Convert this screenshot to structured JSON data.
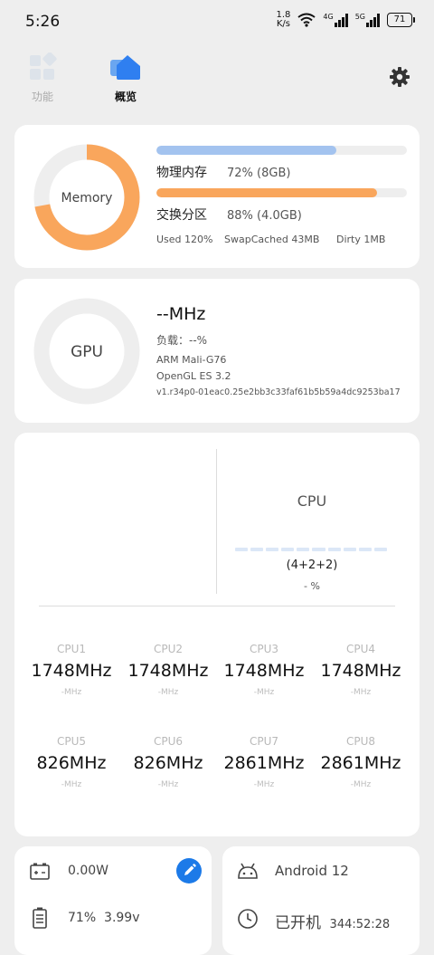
{
  "status_bar": {
    "time": "5:26",
    "net_speed_value": "1.8",
    "net_speed_unit": "K/s",
    "signal1_label": "4G",
    "signal2_label": "5G",
    "battery": "71"
  },
  "tabs": [
    {
      "label": "功能"
    },
    {
      "label": "概览"
    }
  ],
  "memory": {
    "ring_label": "Memory",
    "ram_label": "物理内存",
    "ram_value": "72% (8GB)",
    "ram_percent": 72,
    "swap_label": "交换分区",
    "swap_value": "88% (4.0GB)",
    "swap_percent": 88,
    "used": "Used 120%",
    "swapcached": "SwapCached 43MB",
    "dirty": "Dirty 1MB",
    "colors": {
      "ram": "#a3c3ef",
      "swap": "#f9a65c"
    }
  },
  "gpu": {
    "ring_label": "GPU",
    "freq": "--MHz",
    "load": "负载：--%",
    "model": "ARM Mali-G76",
    "opengl": "OpenGL ES 3.2",
    "driver": "v1.r34p0-01eac0.25e2bb3c33faf61b5b59a4dc9253ba17"
  },
  "cpu": {
    "title": "CPU",
    "cluster": "(4+2+2)",
    "load": "- %",
    "cores": [
      {
        "name": "CPU1",
        "freq": "1748MHz",
        "sub": "-MHz"
      },
      {
        "name": "CPU2",
        "freq": "1748MHz",
        "sub": "-MHz"
      },
      {
        "name": "CPU3",
        "freq": "1748MHz",
        "sub": "-MHz"
      },
      {
        "name": "CPU4",
        "freq": "1748MHz",
        "sub": "-MHz"
      },
      {
        "name": "CPU5",
        "freq": "826MHz",
        "sub": "-MHz"
      },
      {
        "name": "CPU6",
        "freq": "826MHz",
        "sub": "-MHz"
      },
      {
        "name": "CPU7",
        "freq": "2861MHz",
        "sub": "-MHz"
      },
      {
        "name": "CPU8",
        "freq": "2861MHz",
        "sub": "-MHz"
      }
    ]
  },
  "power": {
    "watts": "0.00W",
    "battery_percent": "71%",
    "voltage": "3.99v"
  },
  "system": {
    "android": "Android 12",
    "uptime_label": "已开机",
    "uptime": "344:52:28"
  }
}
